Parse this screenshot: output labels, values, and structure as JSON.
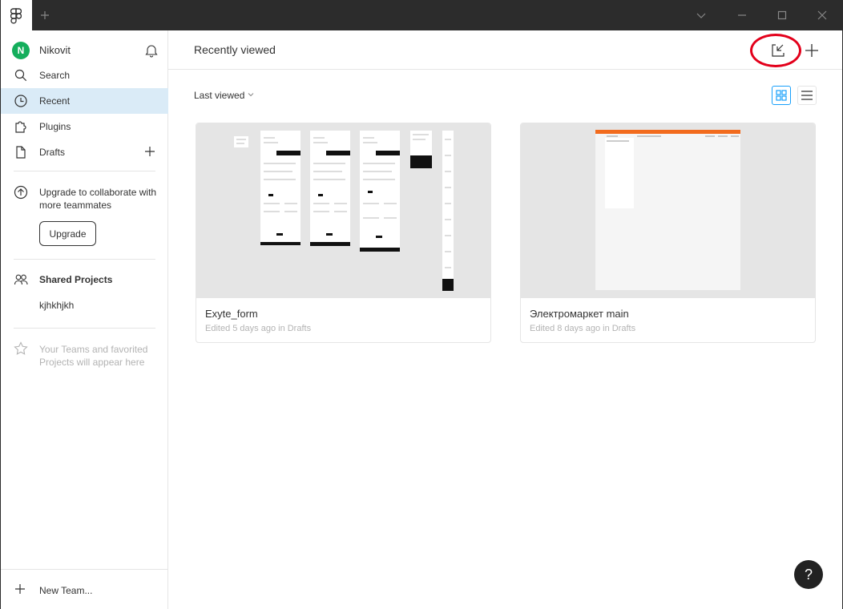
{
  "sidebar": {
    "user": {
      "initial": "N",
      "name": "Nikovit",
      "avatar_color": "#14ae5c"
    },
    "nav": [
      {
        "label": "Search",
        "icon": "search-icon"
      },
      {
        "label": "Recent",
        "icon": "clock-icon",
        "active": true
      },
      {
        "label": "Plugins",
        "icon": "puzzle-icon"
      },
      {
        "label": "Drafts",
        "icon": "file-icon"
      }
    ],
    "upgrade": {
      "text": "Upgrade to collaborate with more teammates",
      "button": "Upgrade"
    },
    "shared": {
      "title": "Shared Projects",
      "items": [
        "kjhkhjkh"
      ]
    },
    "empty_teams": "Your Teams and favorited Projects will appear here",
    "new_team": "New Team..."
  },
  "main": {
    "title": "Recently viewed",
    "sort_label": "Last viewed",
    "files": [
      {
        "name": "Exyte_form",
        "meta": "Edited 5 days ago in Drafts"
      },
      {
        "name": "Электромаркет main",
        "meta": "Edited 8 days ago in Drafts"
      }
    ],
    "help": "?"
  },
  "colors": {
    "accent": "#18a0fb",
    "active_nav": "#daebf7",
    "annotation": "#e3001b",
    "titlebar": "#2c2c2c"
  }
}
